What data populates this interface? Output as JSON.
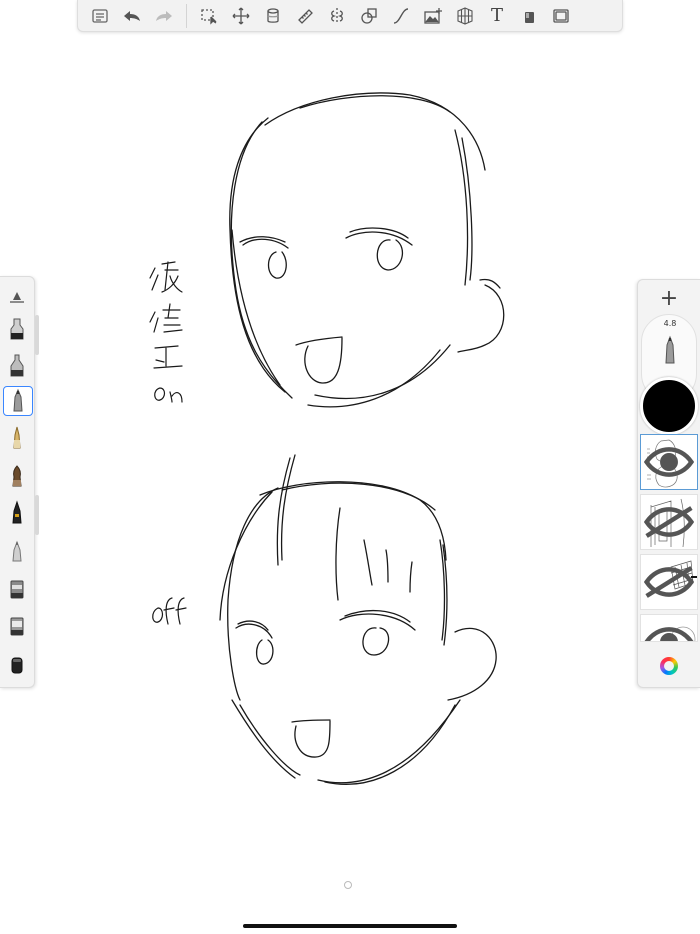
{
  "toolbar": {
    "items": [
      "gallery",
      "undo",
      "redo",
      "selection",
      "transform",
      "fill",
      "ruler",
      "symmetry",
      "shape",
      "curve",
      "import-image",
      "perspective",
      "text",
      "lock",
      "fullscreen"
    ],
    "text_tool_label": "T"
  },
  "canvas": {
    "note_top": "後修正on",
    "note_bottom": "off",
    "stroke_color": "#1a1a1a"
  },
  "brush_palette": {
    "selected_index": 3,
    "brushes": [
      "brush-size-slider",
      "ink-pen",
      "chisel-marker",
      "pencil",
      "fountain-pen",
      "paint-brush",
      "technical-pen",
      "airbrush",
      "eraser",
      "soft-eraser",
      "smudge"
    ]
  },
  "brush_puck": {
    "size_value": "4.8",
    "color": "#000000"
  },
  "layers_panel": {
    "add_label": "+",
    "layers": [
      "layer-1",
      "layer-2",
      "layer-3",
      "layer-4"
    ],
    "active_index": 0
  }
}
